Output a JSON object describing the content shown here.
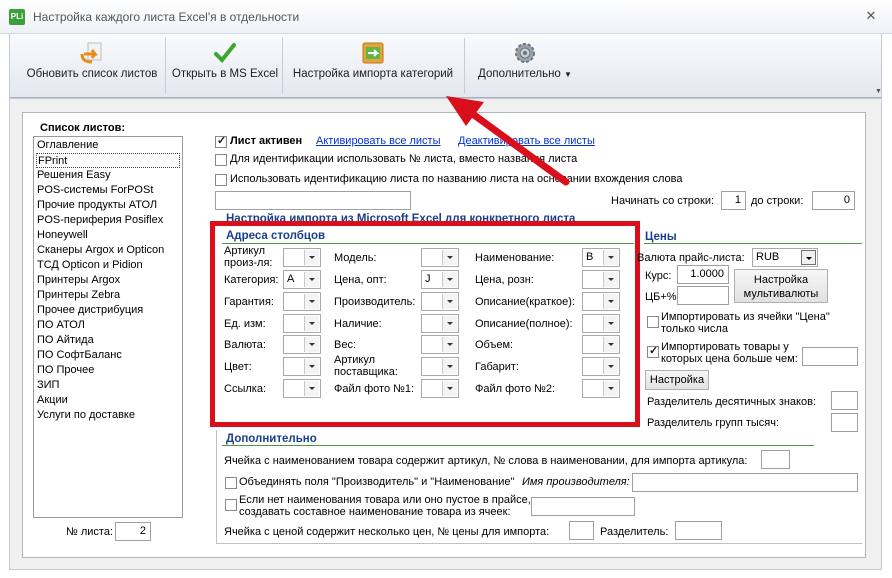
{
  "window": {
    "title": "Настройка каждого листа Excel'я в отдельности",
    "app_icon_text": "PLi"
  },
  "toolbar": {
    "refresh_label": "Обновить список листов",
    "open_excel_label": "Открыть в MS Excel",
    "import_settings_label": "Настройка импорта категорий",
    "more_label": "Дополнительно"
  },
  "sidebar": {
    "title": "Список листов:",
    "items": [
      "Оглавление",
      "FPrint",
      "Решения Easy",
      "POS-системы ForPOSt",
      "Прочие продукты АТОЛ",
      "POS-периферия Posiflex",
      "Honeywell",
      "Сканеры Argox и Opticon",
      "ТСД Opticon и Pidion",
      "Принтеры Argox",
      "Принтеры Zebra",
      "Прочее дистрибуция",
      "ПО АТОЛ",
      "ПО Айтида",
      "ПО СофтБаланс",
      "ПО Прочее",
      "ЗИП",
      "Акции",
      "Услуги по доставке"
    ],
    "selected_index": 1,
    "sheet_no_label": "№ листа:",
    "sheet_no_value": "2"
  },
  "top": {
    "sheet_active_label": "Лист активен",
    "sheet_active_checked": true,
    "activate_all": "Активировать все листы",
    "deactivate_all": "Деактивировать все листы",
    "use_number_label": "Для идентификации использовать № листа, вместо названия листа",
    "use_name_label": "Использовать идентификацию листа по названию листа на основании вхождения слова",
    "start_row_label": "Начинать со строки:",
    "start_row_value": "1",
    "end_row_label": "до строки:",
    "end_row_value": "0",
    "section_title": "Настройка импорта из Microsoft Excel для конкретного листа"
  },
  "columns": {
    "title": "Адреса столбцов",
    "fields": [
      {
        "label": "Артикул произ-ля:",
        "value": ""
      },
      {
        "label": "Модель:",
        "value": ""
      },
      {
        "label": "Наименование:",
        "value": "B"
      },
      {
        "label": "Категория:",
        "value": "A"
      },
      {
        "label": "Цена, опт:",
        "value": "J"
      },
      {
        "label": "Цена, розн:",
        "value": ""
      },
      {
        "label": "Гарантия:",
        "value": ""
      },
      {
        "label": "Производитель:",
        "value": ""
      },
      {
        "label": "Описание(краткое):",
        "value": ""
      },
      {
        "label": "Ед. изм:",
        "value": ""
      },
      {
        "label": "Наличие:",
        "value": ""
      },
      {
        "label": "Описание(полное):",
        "value": ""
      },
      {
        "label": "Валюта:",
        "value": ""
      },
      {
        "label": "Вес:",
        "value": ""
      },
      {
        "label": "Объем:",
        "value": ""
      },
      {
        "label": "Цвет:",
        "value": ""
      },
      {
        "label": "Артикул поставщика:",
        "value": ""
      },
      {
        "label": "Габарит:",
        "value": ""
      },
      {
        "label": "Ссылка:",
        "value": ""
      },
      {
        "label": "Файл фото №1:",
        "value": ""
      },
      {
        "label": "Файл фото №2:",
        "value": ""
      }
    ]
  },
  "prices": {
    "title": "Цены",
    "currency_label": "Валюта прайс-листа:",
    "currency_value": "RUB",
    "rate_label": "Курс:",
    "rate_value": "1.0000",
    "cb_label": "ЦБ+%",
    "cb_value": "",
    "multicurrency_btn": "Настройка мультивалюты",
    "import_from_price_label": "Импортировать из ячейки \"Цена\" только числа",
    "import_from_price_checked": false,
    "import_more_label": "Импортировать товары у которых цена больше чем:",
    "import_more_checked": true,
    "setup_btn": "Настройка",
    "decimal_sep_label": "Разделитель десятичных знаков:",
    "group_sep_label": "Разделитель групп тысяч:"
  },
  "extra": {
    "title": "Дополнительно",
    "article_label": "Ячейка с наименованием товара содержит артикул, № слова в наименовании, для импорта артикула:",
    "merge_label": "Объединять поля \"Производитель\" и \"Наименование\"",
    "manufacturer_name_label": "Имя производителя:",
    "compose_label_1": "Если нет наименования товара или оно пустое в прайсе,",
    "compose_label_2": "создавать составное наименование товара из ячеек:",
    "multi_price_label": "Ячейка с ценой содержит несколько цен, № цены для импорта:",
    "separator_label": "Разделитель:"
  },
  "colors": {
    "annotation_red": "#d90f1b",
    "group_title": "#1b3f8a",
    "link": "#0033cc"
  }
}
